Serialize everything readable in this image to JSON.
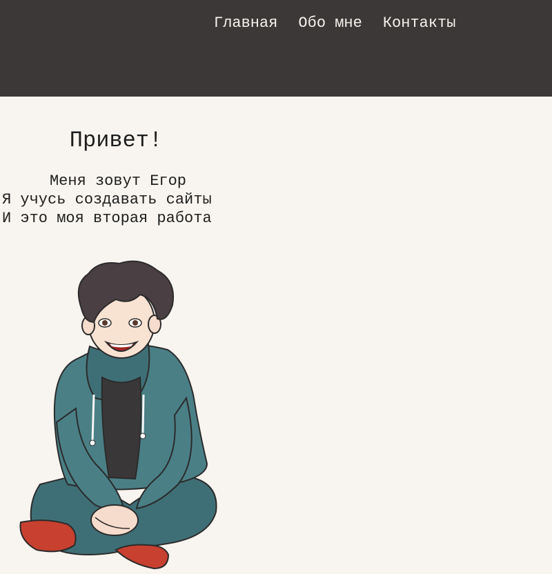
{
  "nav": {
    "items": [
      {
        "label": "Главная"
      },
      {
        "label": "Обо мне"
      },
      {
        "label": "Контакты"
      }
    ]
  },
  "hero": {
    "title": "Привет!",
    "lines": [
      "Меня зовут Егор",
      "Я учусь создавать сайты",
      "И это моя вторая работа"
    ]
  },
  "colors": {
    "header_bg": "#3c3838",
    "page_bg": "#f8f5f0",
    "nav_text": "#f6f2ec",
    "body_text": "#1e1e1e",
    "hoodie": "#4a7f86",
    "shoes": "#c8402f"
  },
  "image": {
    "icon": "cartoon-boy-illustration"
  }
}
